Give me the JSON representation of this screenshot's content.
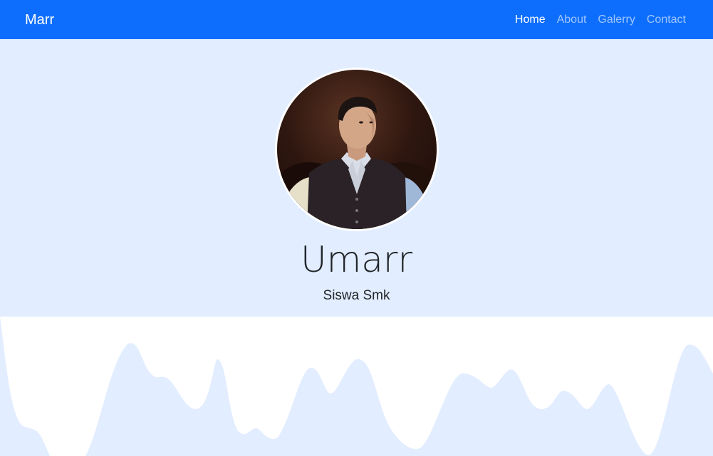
{
  "navbar": {
    "brand": "Marr",
    "links": [
      {
        "label": "Home",
        "active": true
      },
      {
        "label": "About",
        "active": false
      },
      {
        "label": "Galerry",
        "active": false
      },
      {
        "label": "Contact",
        "active": false
      }
    ]
  },
  "hero": {
    "name": "Umarr",
    "subtitle": "Siswa Smk"
  },
  "colors": {
    "primary": "#0d6efd",
    "hero_bg": "#e2edff",
    "wave": "#e2edff"
  }
}
